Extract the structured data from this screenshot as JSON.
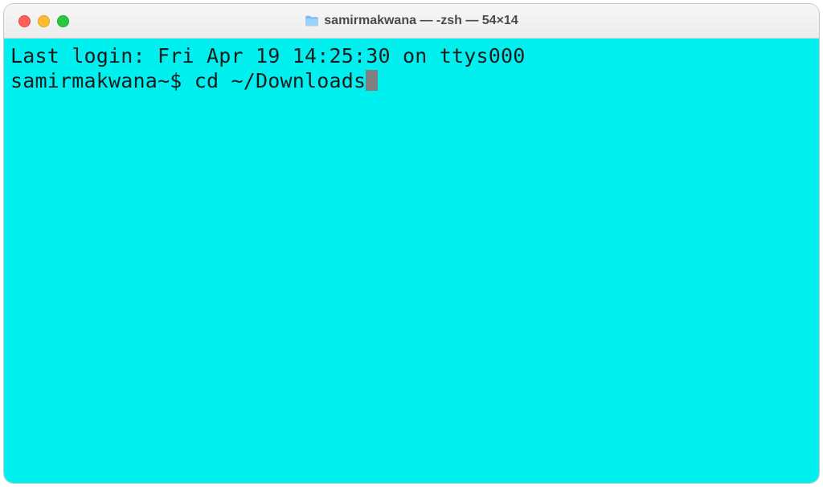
{
  "window": {
    "title": "samirmakwana — -zsh — 54×14"
  },
  "terminal": {
    "bg_color": "#00f0f0",
    "text_color": "#1d1d1d",
    "last_login_line": "Last login: Fri Apr 19 14:25:30 on ttys000",
    "prompt": "samirmakwana~$ ",
    "command": "cd ~/Downloads"
  }
}
